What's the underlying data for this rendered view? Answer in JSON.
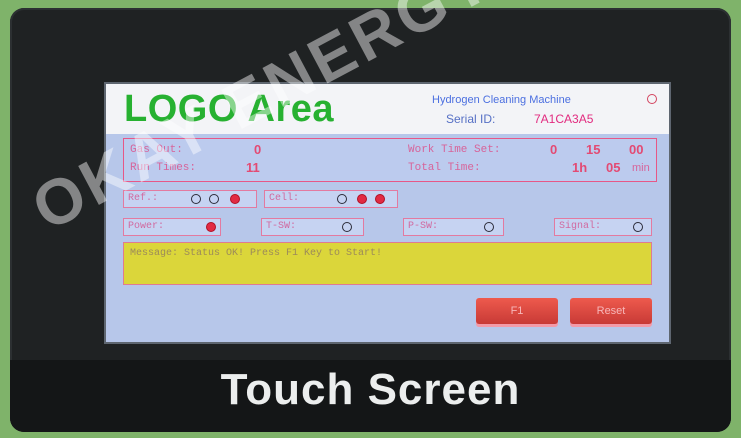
{
  "header": {
    "logo": "LOGO Area",
    "machine": "Hydrogen Cleaning Machine",
    "serial_label": "Serial ID:",
    "serial_value": "7A1CA3A5"
  },
  "status": {
    "gas_out_label": "Gas Out:",
    "gas_out_value": "0",
    "run_times_label": "Run Times:",
    "run_times_value": "11",
    "work_time_label": "Work Time Set:",
    "work_time_h": "0",
    "work_time_m": "15",
    "work_time_s": "00",
    "total_time_label": "Total Time:",
    "total_time_h": "1h",
    "total_time_m": "05",
    "total_time_unit": "min"
  },
  "indicators": {
    "ref_label": "Ref.:",
    "cell_label": "Cell:",
    "power_label": "Power:",
    "tsw_label": "T-SW:",
    "psw_label": "P-SW:",
    "signal_label": "Signal:"
  },
  "message": "Message: Status OK! Press F1 Key to Start!",
  "buttons": {
    "f1": "F1",
    "reset": "Reset"
  },
  "watermark": "OKAY ENERGY",
  "footer": "Touch Screen",
  "colors": {
    "logo_green": "#27b131",
    "message_yellow": "#dbd63a",
    "button_red": "#e0483f",
    "indicator_on": "#e22a43"
  }
}
